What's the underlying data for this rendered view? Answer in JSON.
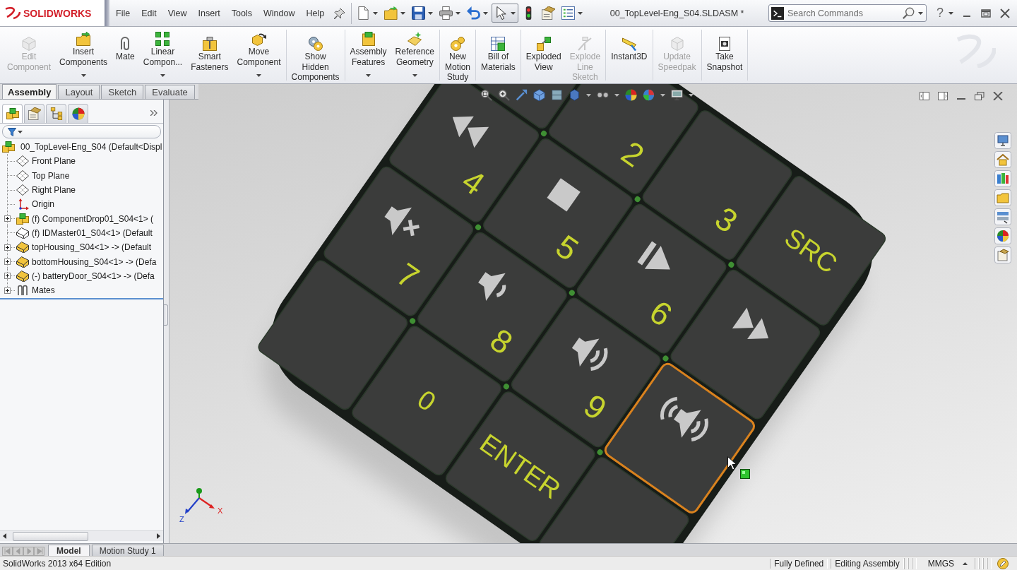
{
  "app_bar": {
    "logo": "SOLIDWORKS",
    "menu": [
      "File",
      "Edit",
      "View",
      "Insert",
      "Tools",
      "Window",
      "Help"
    ],
    "quick_access": [
      {
        "kind": "new",
        "dropdown": true,
        "pressed": false
      },
      {
        "kind": "open",
        "dropdown": true,
        "pressed": false
      },
      {
        "kind": "save",
        "dropdown": true,
        "pressed": false
      },
      {
        "kind": "print",
        "dropdown": true,
        "pressed": false
      },
      {
        "kind": "undo",
        "dropdown": true,
        "pressed": false
      },
      {
        "kind": "select",
        "dropdown": true,
        "pressed": true
      },
      {
        "kind": "rebuild",
        "dropdown": false,
        "pressed": false
      },
      {
        "kind": "options",
        "dropdown": false,
        "pressed": false
      },
      {
        "kind": "properties",
        "dropdown": true,
        "pressed": false
      }
    ],
    "document_title": "00_TopLevel-Eng_S04.SLDASM *",
    "search": {
      "placeholder": "Search Commands"
    },
    "help": "?"
  },
  "ribbon": {
    "groups": [
      [
        {
          "kind": "edit",
          "label": "Edit\nComponent",
          "dropdown": false,
          "disabled": true
        },
        {
          "kind": "insert",
          "label": "Insert\nComponents",
          "dropdown": true,
          "disabled": false
        },
        {
          "kind": "mate",
          "label": "Mate",
          "dropdown": false,
          "disabled": false
        },
        {
          "kind": "pattern",
          "label": "Linear\nCompon...",
          "dropdown": true,
          "disabled": false
        },
        {
          "kind": "fasteners",
          "label": "Smart\nFasteners",
          "dropdown": false,
          "disabled": false
        },
        {
          "kind": "move",
          "label": "Move\nComponent",
          "dropdown": true,
          "disabled": false
        }
      ],
      [
        {
          "kind": "show",
          "label": "Show\nHidden\nComponents",
          "dropdown": false,
          "disabled": false
        }
      ],
      [
        {
          "kind": "features",
          "label": "Assembly\nFeatures",
          "dropdown": true,
          "disabled": false
        },
        {
          "kind": "geometry",
          "label": "Reference\nGeometry",
          "dropdown": true,
          "disabled": false
        }
      ],
      [
        {
          "kind": "motion",
          "label": "New\nMotion\nStudy",
          "dropdown": false,
          "disabled": false
        }
      ],
      [
        {
          "kind": "bom",
          "label": "Bill of\nMaterials",
          "dropdown": false,
          "disabled": false
        }
      ],
      [
        {
          "kind": "explode",
          "label": "Exploded\nView",
          "dropdown": false,
          "disabled": false
        },
        {
          "kind": "sketch",
          "label": "Explode\nLine\nSketch",
          "dropdown": false,
          "disabled": true
        }
      ],
      [
        {
          "kind": "instant3d",
          "label": "Instant3D",
          "dropdown": false,
          "disabled": false
        }
      ],
      [
        {
          "kind": "speedpak",
          "label": "Update\nSpeedpak",
          "dropdown": false,
          "disabled": true
        }
      ],
      [
        {
          "kind": "snapshot",
          "label": "Take\nSnapshot",
          "dropdown": false,
          "disabled": false
        }
      ]
    ]
  },
  "command_tabs": [
    {
      "label": "Assembly",
      "selected": true
    },
    {
      "label": "Layout",
      "selected": false
    },
    {
      "label": "Sketch",
      "selected": false
    },
    {
      "label": "Evaluate",
      "selected": false
    }
  ],
  "feature_manager": {
    "tabs": [
      {
        "kind": "tree",
        "selected": true
      },
      {
        "kind": "properties",
        "selected": false
      },
      {
        "kind": "config",
        "selected": false
      },
      {
        "kind": "display",
        "selected": false
      }
    ],
    "tree": {
      "label": "00_TopLevel-Eng_S04 (Default<Displ",
      "kind": "assembly",
      "children": [
        {
          "label": "Front Plane",
          "kind": "plane",
          "expandable": false
        },
        {
          "label": "Top Plane",
          "kind": "plane",
          "expandable": false
        },
        {
          "label": "Right Plane",
          "kind": "plane",
          "expandable": false
        },
        {
          "label": "Origin",
          "kind": "origin",
          "expandable": false
        },
        {
          "label": "(f) ComponentDrop01_S04<1> (",
          "kind": "assembly",
          "expandable": true,
          "expanded": false
        },
        {
          "label": "(f) IDMaster01_S04<1> (Default",
          "kind": "hidden",
          "expandable": false
        },
        {
          "label": "topHousing_S04<1> -> (Default",
          "kind": "part",
          "expandable": true,
          "expanded": false
        },
        {
          "label": "bottomHousing_S04<1> -> (Defa",
          "kind": "part",
          "expandable": true,
          "expanded": false
        },
        {
          "label": "(-) batteryDoor_S04<1> -> (Defa",
          "kind": "part",
          "expandable": true,
          "expanded": false
        },
        {
          "label": "Mates",
          "kind": "mates",
          "expandable": true,
          "expanded": false
        }
      ]
    }
  },
  "viewport": {
    "keypad": {
      "keys": [
        {
          "kind": "blank",
          "selected": false
        },
        {
          "kind": "number",
          "label": "2",
          "selected": false
        },
        {
          "kind": "number",
          "label": "3",
          "selected": false
        },
        {
          "kind": "text",
          "label": "SRC",
          "selected": false
        },
        {
          "kind": "rewind",
          "label": "4",
          "selected": false
        },
        {
          "kind": "stop",
          "label": "5",
          "selected": false
        },
        {
          "kind": "play",
          "label": "6",
          "selected": false
        },
        {
          "kind": "forward",
          "selected": false
        },
        {
          "kind": "mute",
          "label": "7",
          "selected": false
        },
        {
          "kind": "quiet",
          "label": "8",
          "selected": false
        },
        {
          "kind": "louder",
          "label": "9",
          "selected": false
        },
        {
          "kind": "loudest",
          "selected": true
        },
        {
          "kind": "blank",
          "selected": false
        },
        {
          "kind": "text",
          "label": "0",
          "selected": false
        },
        {
          "kind": "text",
          "label": "ENTER",
          "selected": false
        },
        {
          "kind": "blank",
          "selected": false
        }
      ]
    },
    "triad": {
      "x_label": "X",
      "z_label": "Z"
    }
  },
  "document_tabs": [
    {
      "label": "Model",
      "selected": true
    },
    {
      "label": "Motion Study 1",
      "selected": false
    }
  ],
  "status_bar": {
    "edition": "SolidWorks 2013 x64 Edition",
    "fields": [
      "Fully Defined",
      "Editing Assembly"
    ],
    "units": "MMGS"
  }
}
